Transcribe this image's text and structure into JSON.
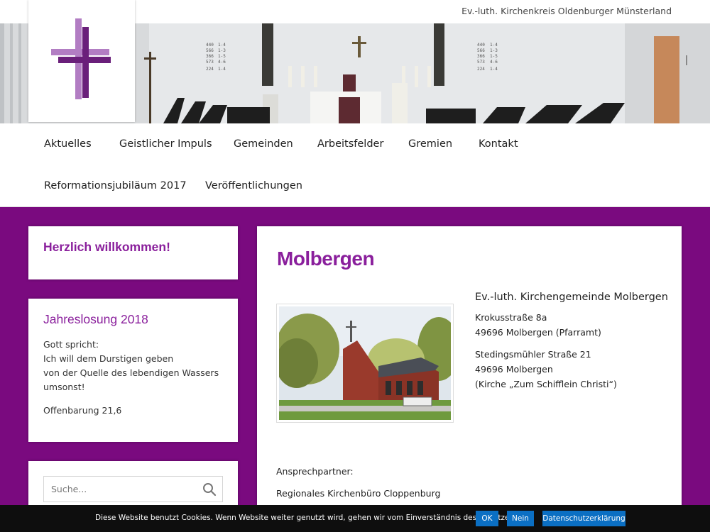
{
  "topbar": {
    "org_name": "Ev.-luth. Kirchenkreis Oldenburger Münsterland"
  },
  "logo": {
    "icon": "cross-icon"
  },
  "nav": {
    "items": [
      "Aktuelles",
      "Geistlicher Impuls",
      "Gemeinden",
      "Arbeitsfelder",
      "Gremien",
      "Kontakt",
      "Reformationsjubiläum 2017",
      "Veröffentlichungen"
    ]
  },
  "sidebar": {
    "welcome": {
      "title": "Herzlich willkommen!"
    },
    "jahreslosung": {
      "title": "Jahreslosung 2018",
      "lines": [
        "Gott spricht:",
        "Ich will dem Durstigen geben",
        "von der Quelle des lebendigen Wassers",
        "umsonst!"
      ],
      "reference": "Offenbarung 21,6"
    },
    "search": {
      "placeholder": "Suche...",
      "icon": "search-icon"
    }
  },
  "content": {
    "title": "Molbergen",
    "org": "Ev.-luth. Kirchengemeinde Molbergen",
    "address1": [
      "Krokusstraße 8a",
      "49696 Molbergen (Pfarramt)"
    ],
    "address2": [
      "Stedingsmühler Straße 21",
      "49696 Molbergen",
      "(Kirche „Zum Schifflein Christi“)"
    ],
    "contact_label": "Ansprechpartner:",
    "contact_org": "Regionales Kirchenbüro Cloppenburg"
  },
  "cookie": {
    "message": "Diese Website benutzt Cookies. Wenn Website weiter genutzt wird, gehen wir vom Einverständnis des Benutzers aus.",
    "ok": "OK",
    "no": "Nein",
    "privacy": "Datenschutzerklärung"
  },
  "colors": {
    "brand": "#7a0a7f",
    "title": "#8a1f9c",
    "cookie_button": "#0b6fc3"
  }
}
